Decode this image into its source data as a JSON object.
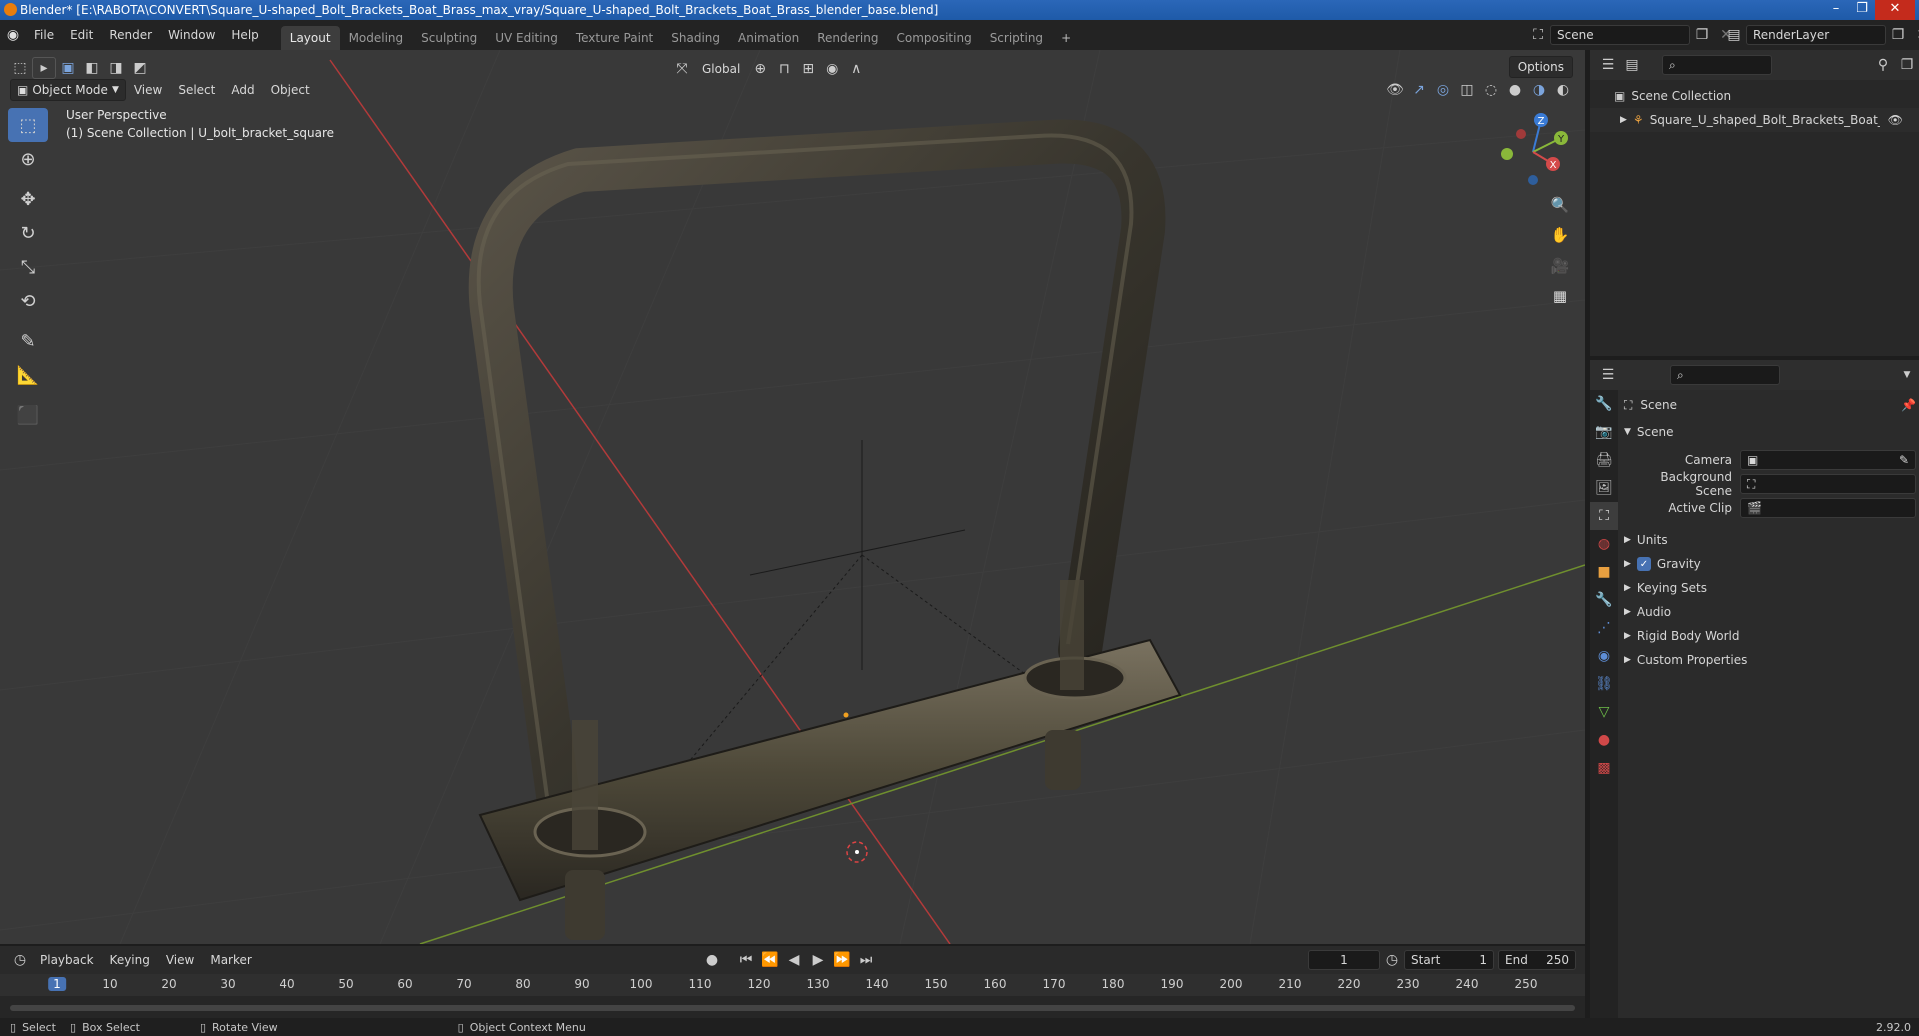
{
  "title_bar": {
    "text": "Blender* [E:\\RABOTA\\CONVERT\\Square_U-shaped_Bolt_Brackets_Boat_Brass_max_vray/Square_U-shaped_Bolt_Brackets_Boat_Brass_blender_base.blend]"
  },
  "menu": [
    "File",
    "Edit",
    "Render",
    "Window",
    "Help"
  ],
  "workspaces": [
    "Layout",
    "Modeling",
    "Sculpting",
    "UV Editing",
    "Texture Paint",
    "Shading",
    "Animation",
    "Rendering",
    "Compositing",
    "Scripting"
  ],
  "scene_field": "Scene",
  "renderlayer_field": "RenderLayer",
  "viewport": {
    "mode": "Object Mode",
    "menus": [
      "View",
      "Select",
      "Add",
      "Object"
    ],
    "transform_orientation": "Global",
    "options_label": "Options",
    "perspective": "User Perspective",
    "collection_info": "(1) Scene Collection | U_bolt_bracket_square",
    "axis_labels": {
      "x": "X",
      "y": "Y",
      "z": "Z"
    }
  },
  "outliner": {
    "root": "Scene Collection",
    "items": [
      "Square_U_shaped_Bolt_Brackets_Boat_Brass"
    ]
  },
  "properties": {
    "header": "Scene",
    "section": "Scene",
    "fields": [
      {
        "label": "Camera",
        "value": ""
      },
      {
        "label": "Background Scene",
        "value": ""
      },
      {
        "label": "Active Clip",
        "value": ""
      }
    ],
    "panels": [
      "Units",
      "Gravity",
      "Keying Sets",
      "Audio",
      "Rigid Body World",
      "Custom Properties"
    ],
    "gravity_checked": true
  },
  "timeline": {
    "menus": [
      "Playback",
      "Keying",
      "View",
      "Marker"
    ],
    "current_frame": "1",
    "start_label": "Start",
    "start": "1",
    "end_label": "End",
    "end": "250",
    "ruler_ticks": [
      "1",
      "10",
      "20",
      "30",
      "40",
      "50",
      "60",
      "70",
      "80",
      "90",
      "100",
      "110",
      "120",
      "130",
      "140",
      "150",
      "160",
      "170",
      "180",
      "190",
      "200",
      "210",
      "220",
      "230",
      "240",
      "250"
    ]
  },
  "statusbar": {
    "items": [
      "Select",
      "Box Select",
      "Rotate View",
      "Object Context Menu"
    ],
    "version": "2.92.0"
  },
  "colors": {
    "accent": "#4772b3",
    "x_axis": "#d44a4a",
    "y_axis": "#8ab83a",
    "z_axis": "#3a7bd5"
  }
}
